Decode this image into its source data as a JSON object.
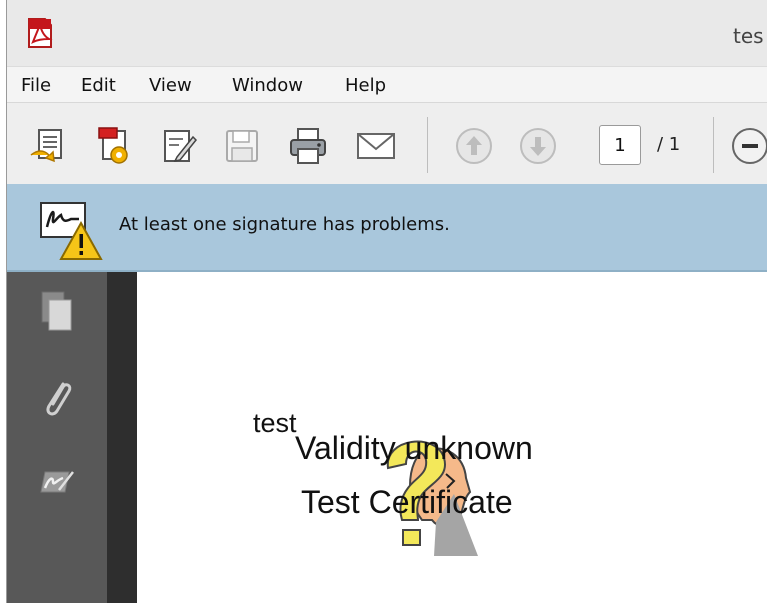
{
  "window": {
    "title": "tes"
  },
  "menu": {
    "items": [
      {
        "label": "File"
      },
      {
        "label": "Edit"
      },
      {
        "label": "View"
      },
      {
        "label": "Window"
      },
      {
        "label": "Help"
      }
    ]
  },
  "toolbar": {
    "page_current": "1",
    "page_total": "/ 1"
  },
  "signature_bar": {
    "message": "At least one signature has problems."
  },
  "document": {
    "field_label": "test",
    "validity_text": "Validity unknown",
    "certificate_text": "Test Certificate"
  },
  "colors": {
    "signature_bar": "#a9c7dc",
    "left_panel": "#585858",
    "warning": "#f5c518"
  }
}
